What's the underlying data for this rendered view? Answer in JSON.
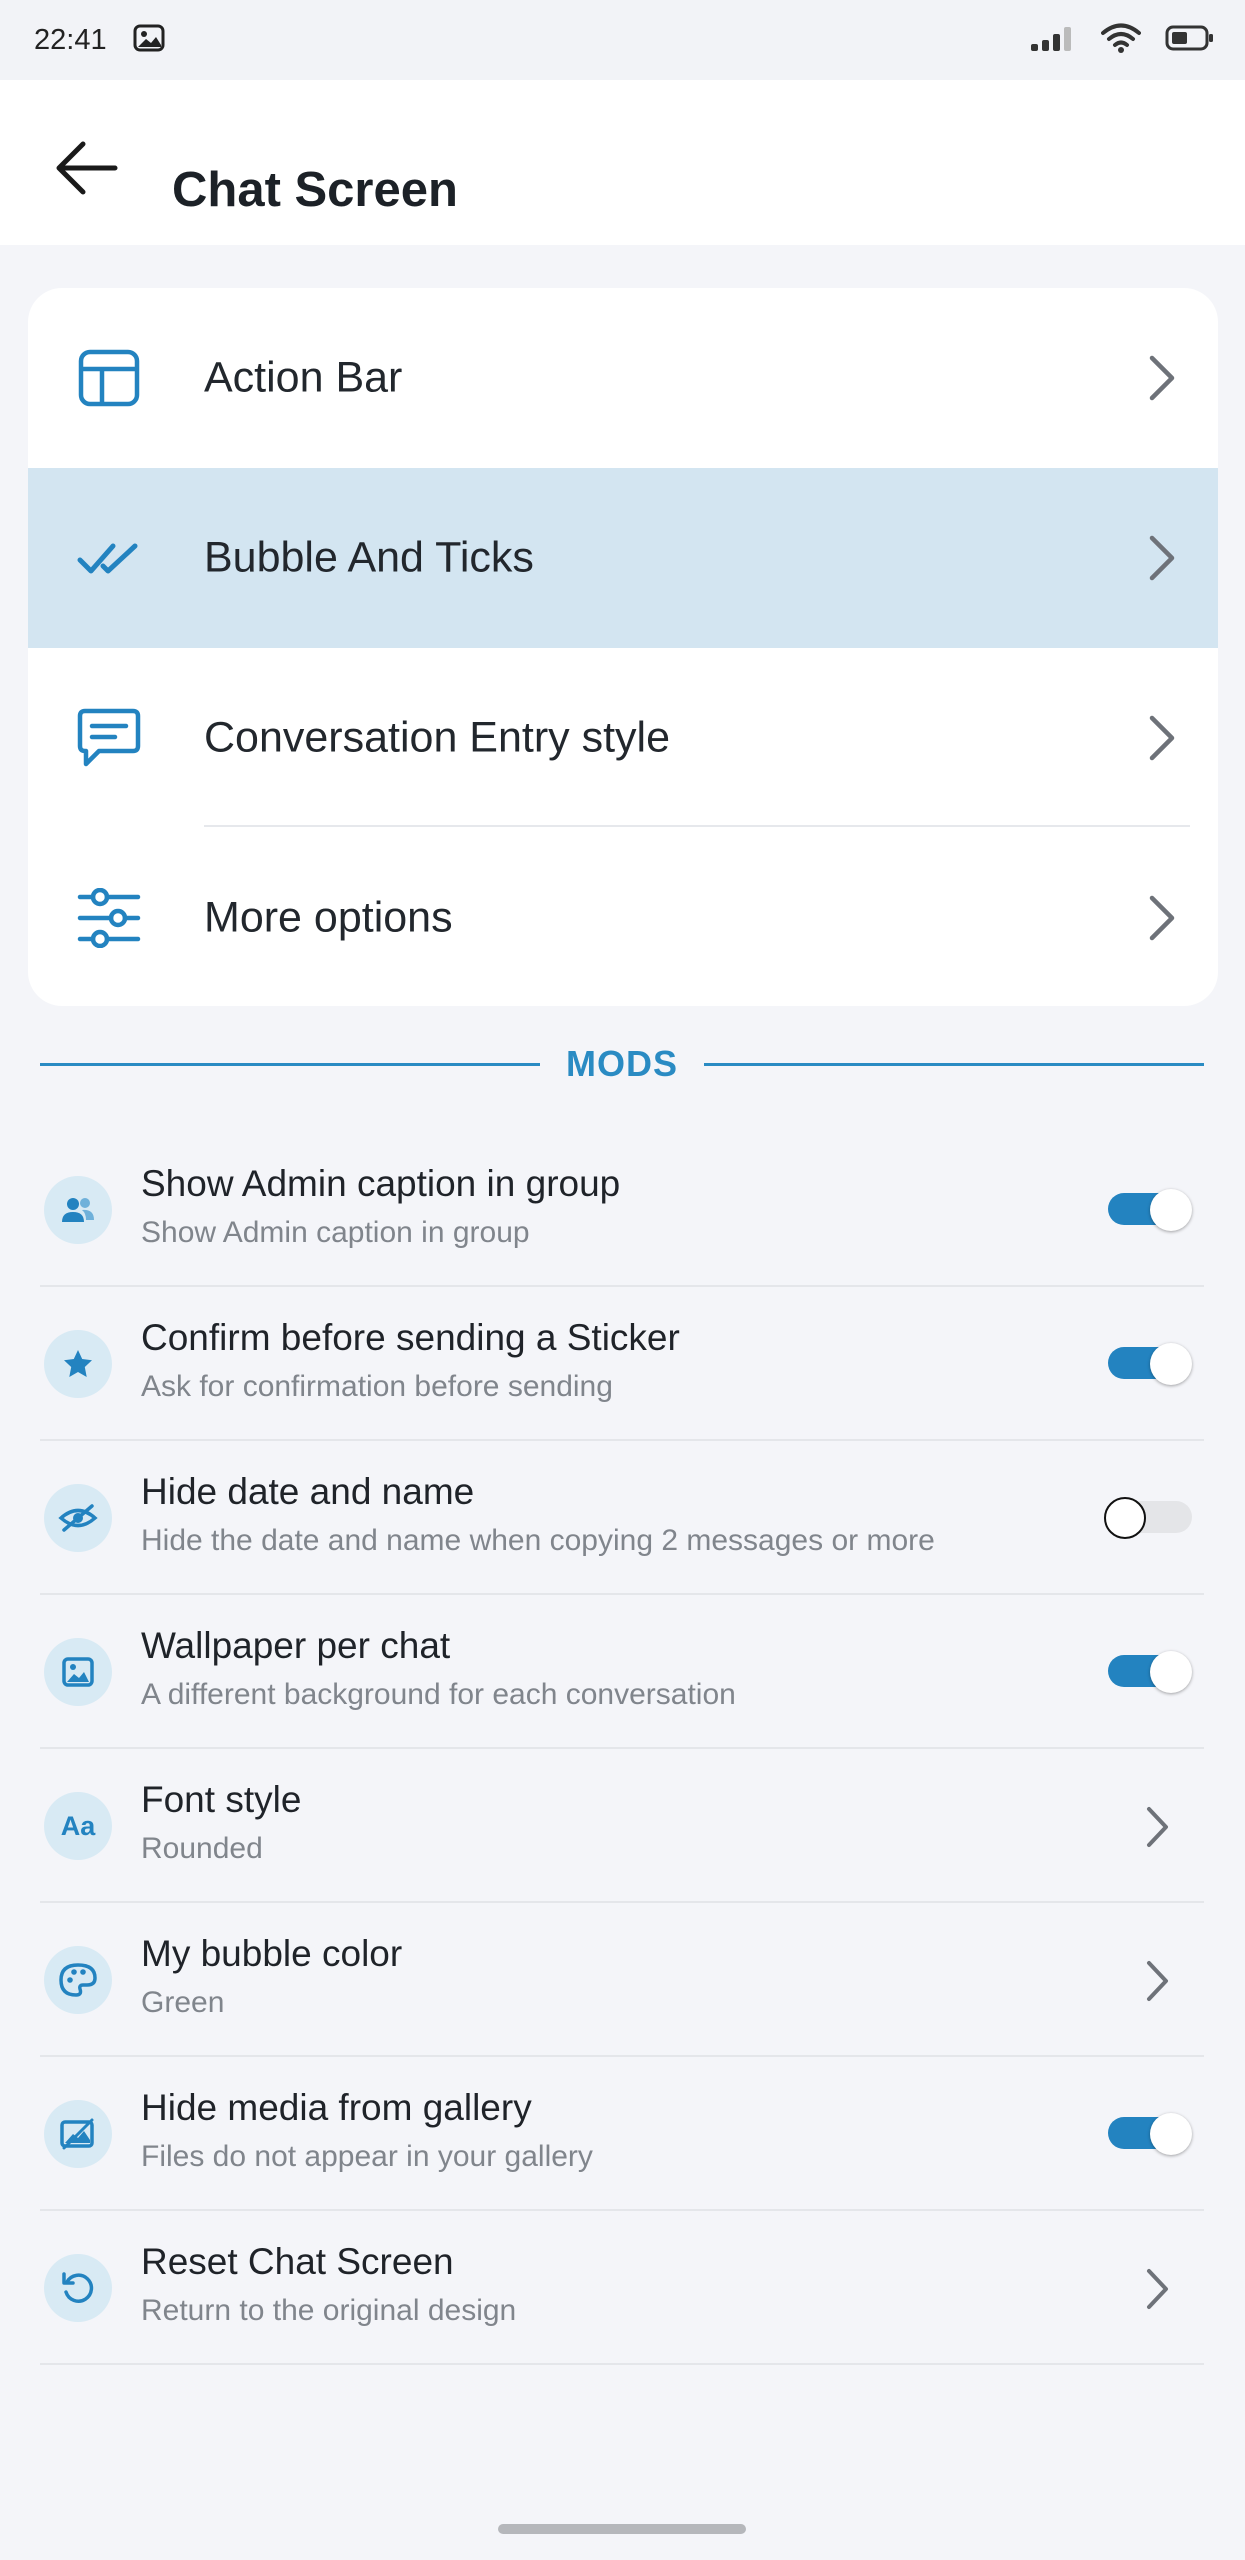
{
  "status_bar": {
    "time": "22:41",
    "icons": [
      "image-notification-icon",
      "signal-icon",
      "wifi-icon",
      "battery-icon"
    ]
  },
  "header": {
    "title": "Chat Screen",
    "back_icon": "arrow-left-icon"
  },
  "menu": {
    "items": [
      {
        "label": "Action Bar",
        "icon": "layout-icon",
        "active": false
      },
      {
        "label": "Bubble And Ticks",
        "icon": "double-check-icon",
        "active": true
      },
      {
        "label": "Conversation Entry style",
        "icon": "chat-bubble-icon",
        "active": false
      },
      {
        "label": "More options",
        "icon": "sliders-icon",
        "active": false
      }
    ]
  },
  "mods": {
    "title": "MODS",
    "items": [
      {
        "title": "Show Admin caption in group",
        "subtitle": "Show Admin caption in group",
        "icon": "users-icon",
        "control": "toggle",
        "on": true
      },
      {
        "title": "Confirm before sending a Sticker",
        "subtitle": "Ask for confirmation before sending",
        "icon": "star-icon",
        "control": "toggle",
        "on": true
      },
      {
        "title": "Hide date and name",
        "subtitle": "Hide the date and name when copying 2 messages or more",
        "icon": "eye-off-icon",
        "control": "toggle",
        "on": false
      },
      {
        "title": "Wallpaper per chat",
        "subtitle": "A different background for each conversation",
        "icon": "image-icon",
        "control": "toggle",
        "on": true
      },
      {
        "title": "Font style",
        "subtitle": "Rounded",
        "icon": "font-icon",
        "icon_text": "Aa",
        "control": "chevron"
      },
      {
        "title": "My bubble color",
        "subtitle": "Green",
        "icon": "palette-icon",
        "control": "chevron"
      },
      {
        "title": "Hide media from gallery",
        "subtitle": "Files do not appear in your gallery",
        "icon": "hidden-image-icon",
        "control": "toggle",
        "on": true
      },
      {
        "title": "Reset Chat Screen",
        "subtitle": "Return to the original design",
        "icon": "reset-icon",
        "control": "chevron"
      }
    ]
  },
  "colors": {
    "accent": "#2383c0",
    "active_row": "#d3e5f1",
    "icon_bg": "#d8eaf4",
    "background": "#f4f5f9"
  }
}
